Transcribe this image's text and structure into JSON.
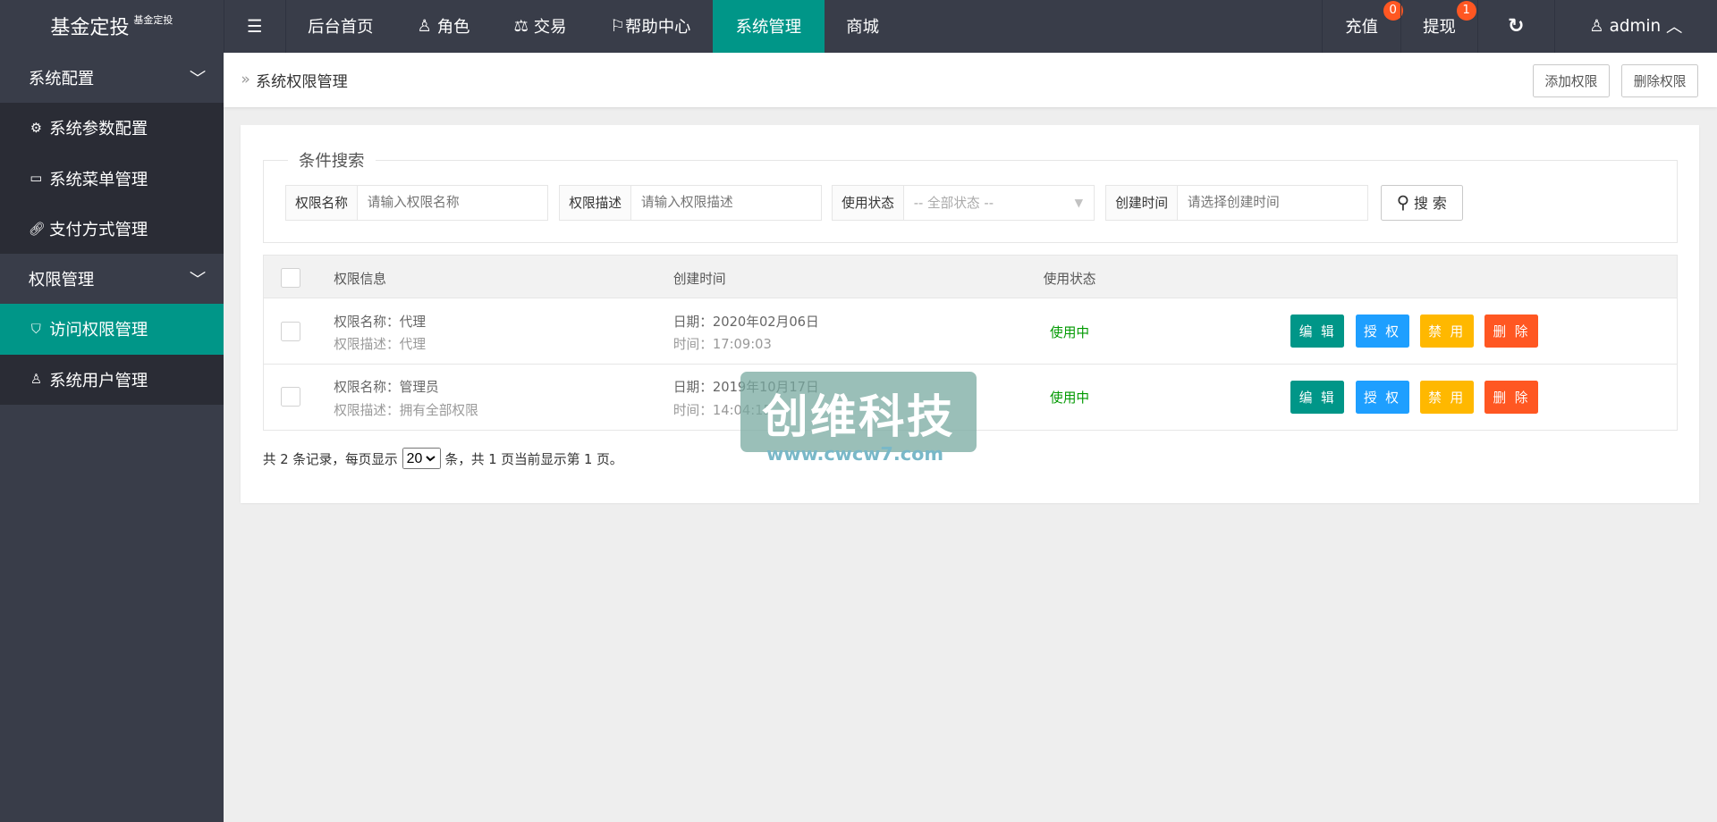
{
  "header": {
    "logo": "基金定投",
    "logo_sub": "基金定投",
    "nav": [
      "后台首页",
      "角色",
      "交易",
      "帮助中心",
      "系统管理",
      "商城"
    ],
    "recharge": "充值",
    "recharge_badge": "0",
    "withdraw": "提现",
    "withdraw_badge": "1",
    "user": "admin"
  },
  "sidebar": {
    "groups": [
      {
        "label": "系统配置",
        "items": [
          "系统参数配置",
          "系统菜单管理",
          "支付方式管理"
        ]
      },
      {
        "label": "权限管理",
        "items": [
          "访问权限管理",
          "系统用户管理"
        ]
      }
    ]
  },
  "breadcrumb": {
    "title": "系统权限管理",
    "add": "添加权限",
    "delete": "删除权限"
  },
  "search": {
    "legend": "条件搜索",
    "name_label": "权限名称",
    "name_ph": "请输入权限名称",
    "desc_label": "权限描述",
    "desc_ph": "请输入权限描述",
    "status_label": "使用状态",
    "status_value": "-- 全部状态 --",
    "time_label": "创建时间",
    "time_ph": "请选择创建时间",
    "button": "搜 索"
  },
  "table": {
    "headers": [
      "权限信息",
      "创建时间",
      "使用状态"
    ],
    "rows": [
      {
        "name": "权限名称：代理",
        "desc": "权限描述：代理",
        "date": "日期：2020年02月06日",
        "time": "时间：17:09:03",
        "status": "使用中"
      },
      {
        "name": "权限名称：管理员",
        "desc": "权限描述：拥有全部权限",
        "date": "日期：2019年10月17日",
        "time": "时间：14:04:15",
        "status": "使用中"
      }
    ],
    "actions": [
      "编 辑",
      "授 权",
      "禁 用",
      "删 除"
    ]
  },
  "pagination": {
    "prefix": "共 2 条记录，每页显示",
    "page_size": "20",
    "suffix": "条，共 1 页当前显示第 1 页。"
  },
  "watermark": {
    "text": "创维科技",
    "url": "www.cwcw7.com"
  },
  "colors": {
    "primary": "#009688",
    "blue": "#1e9fff",
    "warn": "#ffb800",
    "danger": "#ff5722",
    "dark": "#393d49"
  }
}
